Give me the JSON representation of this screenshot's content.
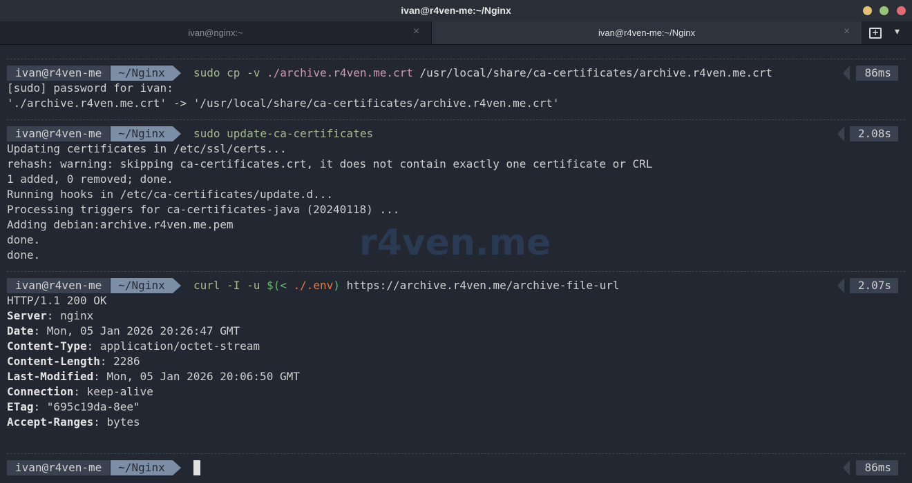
{
  "window": {
    "title": "ivan@r4ven-me:~/Nginx",
    "colors": {
      "minimize": "#e5c07b",
      "maximize": "#98c379",
      "close": "#e06c75"
    }
  },
  "tabs": [
    {
      "label": "ivan@nginx:~",
      "close": "×",
      "active": false
    },
    {
      "label": "ivan@r4ven-me:~/Nginx",
      "close": "×",
      "active": true
    }
  ],
  "tab_controls": {
    "new_tab_icon": "new-tab-icon",
    "menu_icon": "chevron-down-icon",
    "menu_glyph": "▾"
  },
  "watermark": "r4ven.me",
  "prompt": {
    "user": "ivan@r4ven-me",
    "dir": "~/Nginx"
  },
  "blocks": [
    {
      "cmd": {
        "c1": "sudo cp -v ",
        "c2": "./archive.r4ven.me.crt",
        "c3": " /usr/local/share/ca-certificates/archive.r4ven.me.crt"
      },
      "time": "86ms",
      "output": [
        "[sudo] password for ivan:",
        "'./archive.r4ven.me.crt' -> '/usr/local/share/ca-certificates/archive.r4ven.me.crt'"
      ]
    },
    {
      "cmd": {
        "c1": "sudo update-ca-certificates"
      },
      "time": "2.08s",
      "output": [
        "Updating certificates in /etc/ssl/certs...",
        "rehash: warning: skipping ca-certificates.crt, it does not contain exactly one certificate or CRL",
        "1 added, 0 removed; done.",
        "Running hooks in /etc/ca-certificates/update.d...",
        "Processing triggers for ca-certificates-java (20240118) ...",
        "Adding debian:archive.r4ven.me.pem",
        "done.",
        "done."
      ]
    },
    {
      "cmd": {
        "c1": "curl -I -u ",
        "c2": "$(<",
        "c3": " ./.env",
        "c4": ")",
        "c5": " https://archive.r4ven.me/archive-file-url"
      },
      "time": "2.07s",
      "status": "HTTP/1.1 200 OK",
      "headers": [
        {
          "name": "Server",
          "value": ": nginx"
        },
        {
          "name": "Date",
          "value": ": Mon, 05 Jan 2026 20:26:47 GMT"
        },
        {
          "name": "Content-Type",
          "value": ": application/octet-stream"
        },
        {
          "name": "Content-Length",
          "value": ": 2286"
        },
        {
          "name": "Last-Modified",
          "value": ": Mon, 05 Jan 2026 20:06:50 GMT"
        },
        {
          "name": "Connection",
          "value": ": keep-alive"
        },
        {
          "name": "ETag",
          "value": ": \"695c19da-8ee\""
        },
        {
          "name": "Accept-Ranges",
          "value": ": bytes"
        }
      ]
    },
    {
      "time": "86ms"
    }
  ]
}
